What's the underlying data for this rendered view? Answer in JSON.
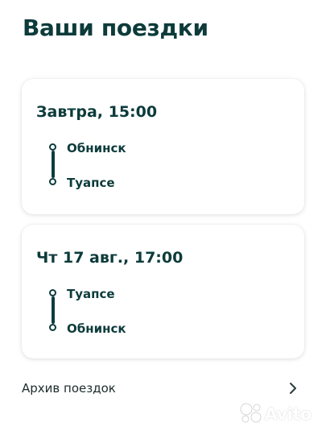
{
  "header": {
    "title": "Ваши поездки"
  },
  "trips": [
    {
      "datetime": "Завтра, 15:00",
      "from": "Обнинск",
      "to": "Туапсе"
    },
    {
      "datetime": "Чт 17 авг., 17:00",
      "from": "Туапсе",
      "to": "Обнинск"
    }
  ],
  "archive": {
    "label": "Архив поездок",
    "icon": "chevron-right-icon"
  },
  "watermark": {
    "text": "Avito"
  },
  "colors": {
    "primary_text": "#0d3b3b",
    "background": "#ffffff"
  }
}
